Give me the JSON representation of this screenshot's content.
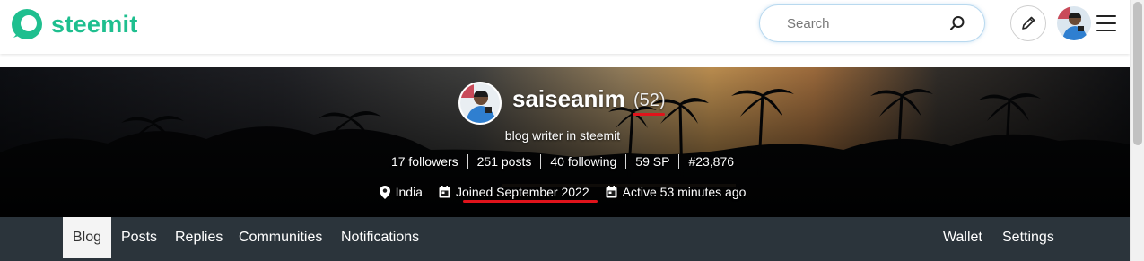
{
  "header": {
    "logo_text": "steemit",
    "brand_color": "#1fbf8f",
    "search_placeholder": "Search",
    "icons": [
      "steemit-logo-icon",
      "search-icon",
      "pencil-icon",
      "menu-icon"
    ]
  },
  "profile": {
    "username": "saiseanim",
    "reputation": "(52)",
    "about": "blog writer in steemit",
    "stats": [
      "17 followers",
      "251 posts",
      "40 following",
      "59 SP",
      "#23,876"
    ],
    "location": "India",
    "joined": "Joined September 2022",
    "active": "Active 53 minutes ago",
    "highlight_color": "#e0131b"
  },
  "nav": {
    "left": [
      "Blog",
      "Posts",
      "Replies",
      "Communities",
      "Notifications"
    ],
    "right": [
      "Wallet",
      "Settings"
    ],
    "active": "Blog",
    "bar_color": "#2b343b"
  }
}
